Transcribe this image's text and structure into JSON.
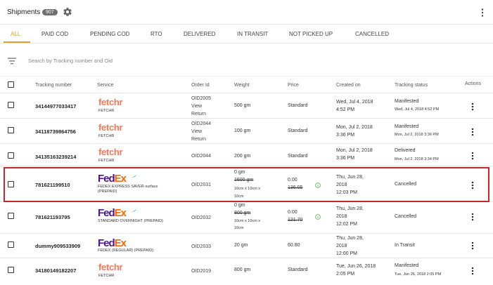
{
  "header": {
    "title": "Shipments",
    "count": "907"
  },
  "search": {
    "placeholder": "Search by Tracking number and Oid"
  },
  "tabs": [
    {
      "label": "ALL"
    },
    {
      "label": "PAID COD"
    },
    {
      "label": "PENDING COD"
    },
    {
      "label": "RTO"
    },
    {
      "label": "DELIVERED"
    },
    {
      "label": "IN TRANSIT"
    },
    {
      "label": "NOT PICKED UP"
    },
    {
      "label": "CANCELLED"
    }
  ],
  "columns": {
    "tracking": "Tracking number",
    "service": "Service",
    "order": "Order Id",
    "weight": "Weight",
    "price": "Price",
    "created": "Created on",
    "status": "Tracking status",
    "actions": "Actions"
  },
  "colors": {
    "accent": "#e0a030",
    "highlight_border": "#c62828",
    "fedex_purple": "#4d148c",
    "fedex_orange": "#ff6600",
    "fetchr": "#f27a5a"
  },
  "rows": [
    {
      "tracking": "34144977033417",
      "logo": "fetchr",
      "logo_text": "fetchr",
      "service": "FETCHR",
      "order": {
        "id": "OID2005",
        "view": "View",
        "return": "Return"
      },
      "weight": "500 gm",
      "price": "Standard",
      "created": {
        "date": "Wed, Jul 4, 2018",
        "time": "4:52 PM"
      },
      "status": "Manifested",
      "status_sub": "Wed, Jul 4, 2018 4:52 PM"
    },
    {
      "tracking": "34118739864756",
      "logo": "fetchr",
      "logo_text": "fetchr",
      "service": "FETCHR",
      "order": {
        "id": "OID2044",
        "view": "View",
        "return": "Return"
      },
      "weight": "100 gm",
      "price": "Standard",
      "created": {
        "date": "Mon, Jul 2, 2018",
        "time": "3:36 PM"
      },
      "status": "Manifested",
      "status_sub": "Mon, Jul 2, 2018 3:36 PM"
    },
    {
      "tracking": "34135163239214",
      "logo": "fetchr",
      "logo_text": "fetchr",
      "service": "FETCHR",
      "order": {
        "id": "OID2044"
      },
      "weight": "200 gm",
      "price": "Standard",
      "created": {
        "date": "Mon, Jul 2, 2018",
        "time": "3:36 PM"
      },
      "status": "Delivered",
      "status_sub": "Mon, Jul 2, 2018 3:34 PM"
    },
    {
      "tracking": "781621199510",
      "logo": "fedex",
      "logo_fed": "Fed",
      "logo_ex": "Ex",
      "service": "FEDEX EXPRESS SAVER-surface",
      "service2": "(PREPAID)",
      "order": {
        "id": "OID2031"
      },
      "weight": "0 gm",
      "weight_old": "1600 gm",
      "dims": "10cm x 10cm x",
      "dims2": "10cm",
      "price": "0.00",
      "price_old": "136.05",
      "created": {
        "day": "Thu, Jun 28,",
        "year": "2018",
        "time": "12:03 PM"
      },
      "status": "Cancelled"
    },
    {
      "tracking": "781621193795",
      "logo": "fedex",
      "logo_fed": "Fed",
      "logo_ex": "Ex",
      "service": "STANDARD OVERNIGHT (PREPAID)",
      "order": {
        "id": "OID2032"
      },
      "weight": "0 gm",
      "weight_old": "800 gm",
      "dims": "10cm x 10cm x",
      "dims2": "10cm",
      "price": "0.00",
      "price_old": "121.70",
      "created": {
        "day": "Thu, Jun 28,",
        "year": "2018",
        "time": "12:02 PM"
      },
      "status": "Cancelled"
    },
    {
      "tracking": "dummy909533909",
      "logo": "fedex",
      "logo_fed": "Fed",
      "logo_ex": "Ex",
      "service": "FEDEX (REGULAR) (PREPAID)",
      "order": {
        "id": "OID2033"
      },
      "weight": "20 gm",
      "price": "60.80",
      "created": {
        "day": "Thu, Jun 28,",
        "year": "2018",
        "time": "12:00 PM"
      },
      "status": "In Transit"
    },
    {
      "tracking": "34180149182207",
      "logo": "fetchr",
      "logo_text": "fetchr",
      "service": "FETCHR",
      "order": {
        "id": "OID2019"
      },
      "weight": "800 gm",
      "price": "Standard",
      "created": {
        "date": "Tue, Jun 26, 2018",
        "time": "2:05 PM"
      },
      "status": "Manifested",
      "status_sub": "Tue, Jun 26, 2018 2:05 PM"
    }
  ]
}
